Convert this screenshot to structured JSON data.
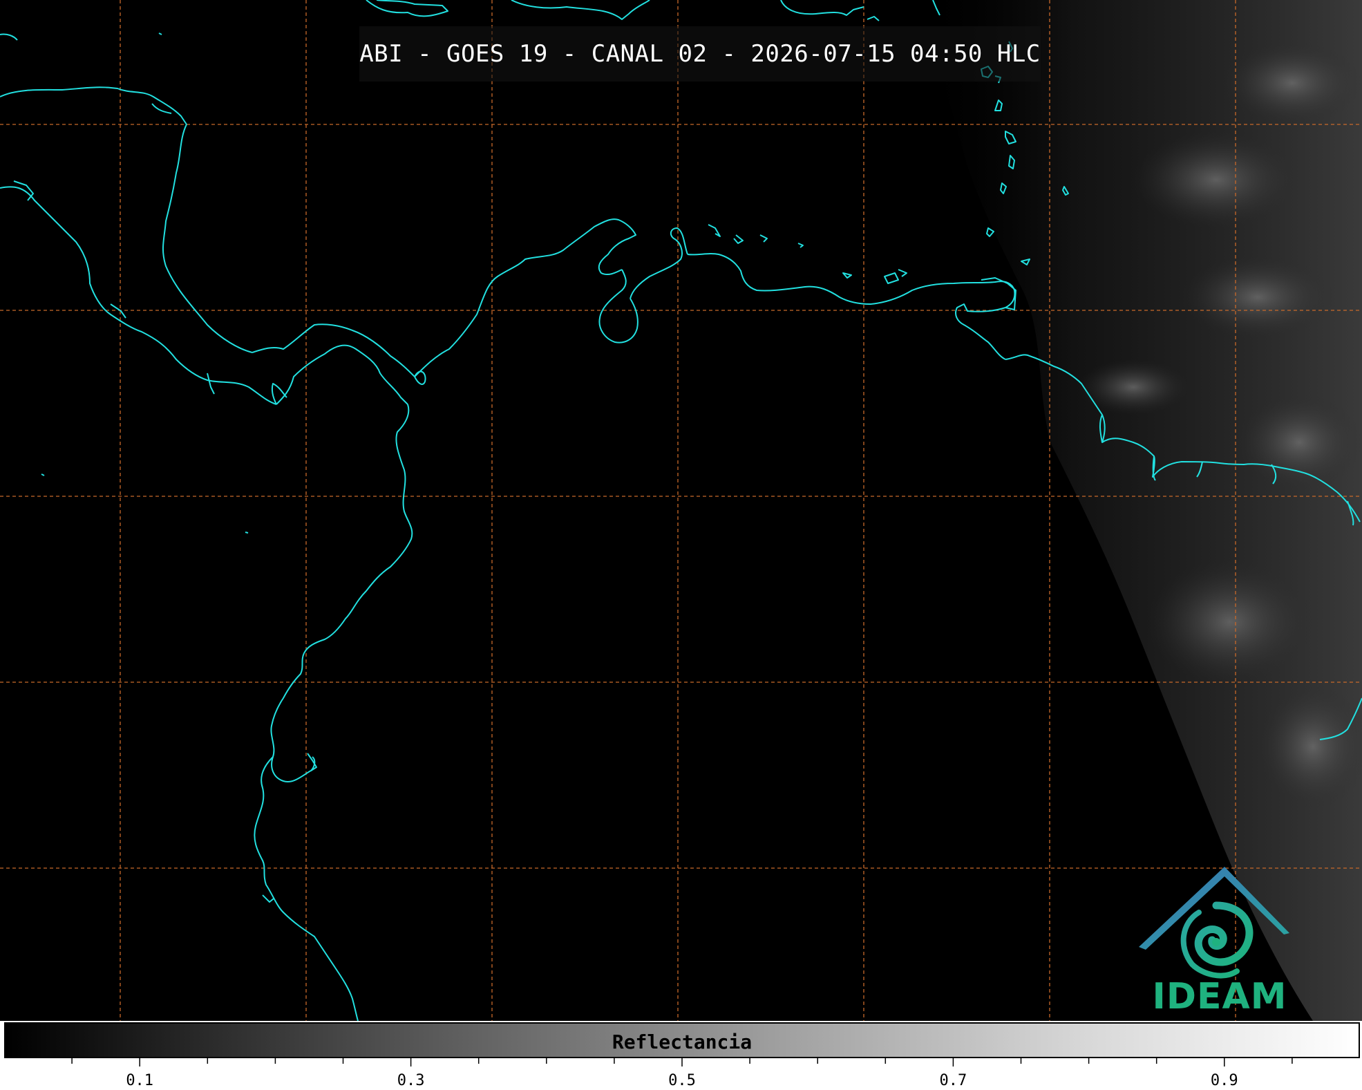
{
  "title": "ABI - GOES 19 - CANAL 02 - 2026-07-15 04:50 HLC",
  "logo": {
    "text": "IDEAM",
    "icon": "ideam-logo-icon"
  },
  "colorbar": {
    "label": "Reflectancia",
    "range": [
      0.0,
      1.0
    ],
    "tick_labels": [
      "0.1",
      "0.3",
      "0.5",
      "0.7",
      "0.9"
    ],
    "tick_values": [
      0.1,
      0.3,
      0.5,
      0.7,
      0.9
    ]
  },
  "colors": {
    "coastline": "#22e0e0",
    "grid": "#c8692a",
    "background": "#000000",
    "logo_green": "#1fb27f",
    "logo_blue": "#3a73b5"
  }
}
